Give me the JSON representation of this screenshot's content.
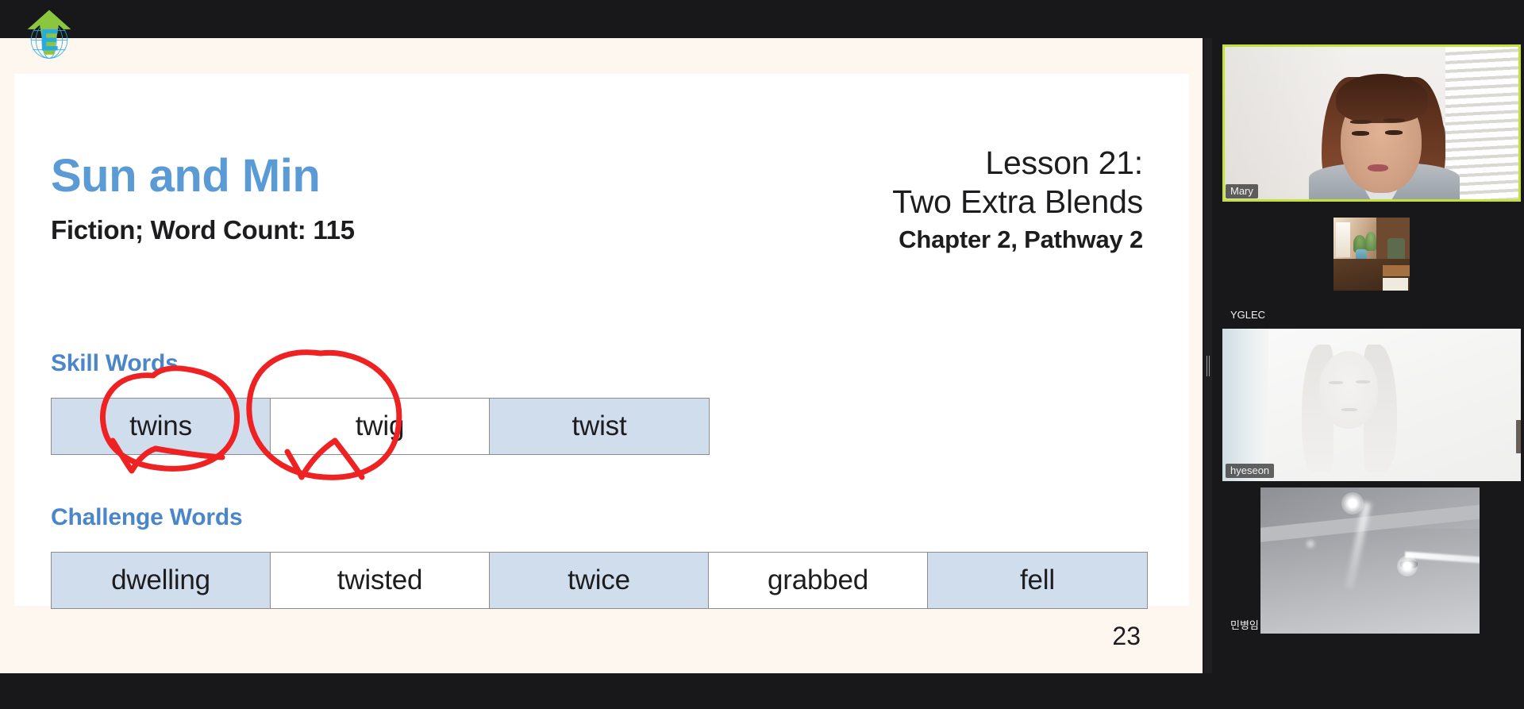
{
  "app": {
    "background_color": "#18181a",
    "accent_active_speaker": "#c4e03a"
  },
  "logo": {
    "name": "organization-logo",
    "letter": "E",
    "arrow_color": "#8cc63f",
    "globe_color": "#29abe2"
  },
  "slide": {
    "page_number": "23",
    "background_color": "#fdf7f0",
    "card_color": "#ffffff",
    "title": "Sun and Min",
    "title_color": "#5b9bd5",
    "subtitle": "Fiction; Word Count: 115",
    "lesson": {
      "line1": "Lesson 21:",
      "line2": "Two Extra Blends",
      "line3": "Chapter 2, Pathway 2"
    },
    "skill_words": {
      "heading": "Skill Words",
      "heading_color": "#4a86c8",
      "cell_shaded_color": "#cfdded",
      "words": [
        "twins",
        "twig",
        "twist"
      ]
    },
    "challenge_words": {
      "heading": "Challenge Words",
      "heading_color": "#4a86c8",
      "words": [
        "dwelling",
        "twisted",
        "twice",
        "grabbed",
        "fell"
      ]
    },
    "annotations": {
      "ink_color": "#ee2222",
      "marks": [
        {
          "name": "circle-around-twins",
          "target": "twins"
        },
        {
          "name": "check-mark-twins",
          "target": "twins"
        },
        {
          "name": "circle-around-twig",
          "target": "twig"
        },
        {
          "name": "check-mark-twig",
          "target": "twig"
        }
      ]
    }
  },
  "splitter": {
    "name": "panel-resize-handle"
  },
  "video_panel": {
    "tiles": [
      {
        "name": "Mary",
        "active_speaker": true,
        "video_on": true,
        "avatar_only": false
      },
      {
        "name": "YGLEC",
        "active_speaker": false,
        "video_on": false,
        "avatar_only": true
      },
      {
        "name": "hyeseon",
        "active_speaker": false,
        "video_on": true,
        "avatar_only": false
      },
      {
        "name": "민병임",
        "active_speaker": false,
        "video_on": true,
        "avatar_only": false
      }
    ]
  }
}
